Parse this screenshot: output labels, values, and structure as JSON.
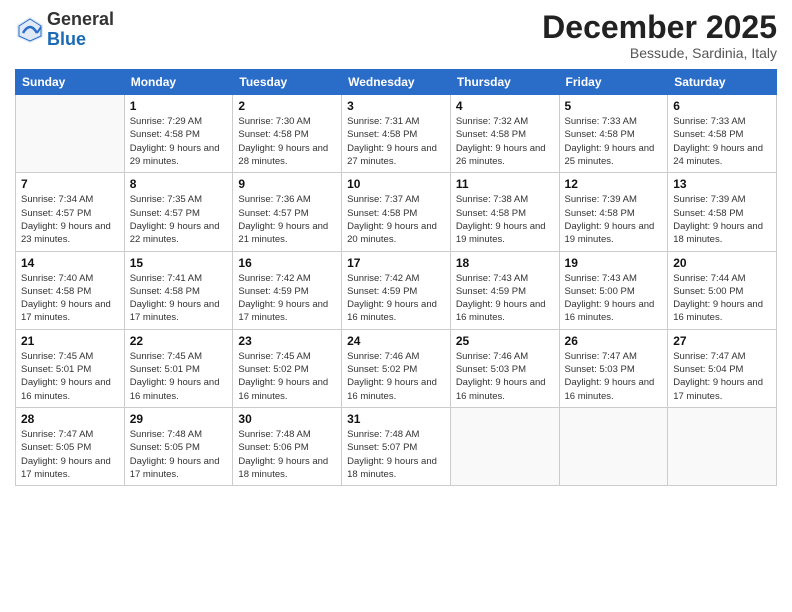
{
  "header": {
    "logo_general": "General",
    "logo_blue": "Blue",
    "month_title": "December 2025",
    "subtitle": "Bessude, Sardinia, Italy"
  },
  "weekdays": [
    "Sunday",
    "Monday",
    "Tuesday",
    "Wednesday",
    "Thursday",
    "Friday",
    "Saturday"
  ],
  "weeks": [
    [
      {
        "day": "",
        "sunrise": "",
        "sunset": "",
        "daylight": ""
      },
      {
        "day": "1",
        "sunrise": "Sunrise: 7:29 AM",
        "sunset": "Sunset: 4:58 PM",
        "daylight": "Daylight: 9 hours and 29 minutes."
      },
      {
        "day": "2",
        "sunrise": "Sunrise: 7:30 AM",
        "sunset": "Sunset: 4:58 PM",
        "daylight": "Daylight: 9 hours and 28 minutes."
      },
      {
        "day": "3",
        "sunrise": "Sunrise: 7:31 AM",
        "sunset": "Sunset: 4:58 PM",
        "daylight": "Daylight: 9 hours and 27 minutes."
      },
      {
        "day": "4",
        "sunrise": "Sunrise: 7:32 AM",
        "sunset": "Sunset: 4:58 PM",
        "daylight": "Daylight: 9 hours and 26 minutes."
      },
      {
        "day": "5",
        "sunrise": "Sunrise: 7:33 AM",
        "sunset": "Sunset: 4:58 PM",
        "daylight": "Daylight: 9 hours and 25 minutes."
      },
      {
        "day": "6",
        "sunrise": "Sunrise: 7:33 AM",
        "sunset": "Sunset: 4:58 PM",
        "daylight": "Daylight: 9 hours and 24 minutes."
      }
    ],
    [
      {
        "day": "7",
        "sunrise": "Sunrise: 7:34 AM",
        "sunset": "Sunset: 4:57 PM",
        "daylight": "Daylight: 9 hours and 23 minutes."
      },
      {
        "day": "8",
        "sunrise": "Sunrise: 7:35 AM",
        "sunset": "Sunset: 4:57 PM",
        "daylight": "Daylight: 9 hours and 22 minutes."
      },
      {
        "day": "9",
        "sunrise": "Sunrise: 7:36 AM",
        "sunset": "Sunset: 4:57 PM",
        "daylight": "Daylight: 9 hours and 21 minutes."
      },
      {
        "day": "10",
        "sunrise": "Sunrise: 7:37 AM",
        "sunset": "Sunset: 4:58 PM",
        "daylight": "Daylight: 9 hours and 20 minutes."
      },
      {
        "day": "11",
        "sunrise": "Sunrise: 7:38 AM",
        "sunset": "Sunset: 4:58 PM",
        "daylight": "Daylight: 9 hours and 19 minutes."
      },
      {
        "day": "12",
        "sunrise": "Sunrise: 7:39 AM",
        "sunset": "Sunset: 4:58 PM",
        "daylight": "Daylight: 9 hours and 19 minutes."
      },
      {
        "day": "13",
        "sunrise": "Sunrise: 7:39 AM",
        "sunset": "Sunset: 4:58 PM",
        "daylight": "Daylight: 9 hours and 18 minutes."
      }
    ],
    [
      {
        "day": "14",
        "sunrise": "Sunrise: 7:40 AM",
        "sunset": "Sunset: 4:58 PM",
        "daylight": "Daylight: 9 hours and 17 minutes."
      },
      {
        "day": "15",
        "sunrise": "Sunrise: 7:41 AM",
        "sunset": "Sunset: 4:58 PM",
        "daylight": "Daylight: 9 hours and 17 minutes."
      },
      {
        "day": "16",
        "sunrise": "Sunrise: 7:42 AM",
        "sunset": "Sunset: 4:59 PM",
        "daylight": "Daylight: 9 hours and 17 minutes."
      },
      {
        "day": "17",
        "sunrise": "Sunrise: 7:42 AM",
        "sunset": "Sunset: 4:59 PM",
        "daylight": "Daylight: 9 hours and 16 minutes."
      },
      {
        "day": "18",
        "sunrise": "Sunrise: 7:43 AM",
        "sunset": "Sunset: 4:59 PM",
        "daylight": "Daylight: 9 hours and 16 minutes."
      },
      {
        "day": "19",
        "sunrise": "Sunrise: 7:43 AM",
        "sunset": "Sunset: 5:00 PM",
        "daylight": "Daylight: 9 hours and 16 minutes."
      },
      {
        "day": "20",
        "sunrise": "Sunrise: 7:44 AM",
        "sunset": "Sunset: 5:00 PM",
        "daylight": "Daylight: 9 hours and 16 minutes."
      }
    ],
    [
      {
        "day": "21",
        "sunrise": "Sunrise: 7:45 AM",
        "sunset": "Sunset: 5:01 PM",
        "daylight": "Daylight: 9 hours and 16 minutes."
      },
      {
        "day": "22",
        "sunrise": "Sunrise: 7:45 AM",
        "sunset": "Sunset: 5:01 PM",
        "daylight": "Daylight: 9 hours and 16 minutes."
      },
      {
        "day": "23",
        "sunrise": "Sunrise: 7:45 AM",
        "sunset": "Sunset: 5:02 PM",
        "daylight": "Daylight: 9 hours and 16 minutes."
      },
      {
        "day": "24",
        "sunrise": "Sunrise: 7:46 AM",
        "sunset": "Sunset: 5:02 PM",
        "daylight": "Daylight: 9 hours and 16 minutes."
      },
      {
        "day": "25",
        "sunrise": "Sunrise: 7:46 AM",
        "sunset": "Sunset: 5:03 PM",
        "daylight": "Daylight: 9 hours and 16 minutes."
      },
      {
        "day": "26",
        "sunrise": "Sunrise: 7:47 AM",
        "sunset": "Sunset: 5:03 PM",
        "daylight": "Daylight: 9 hours and 16 minutes."
      },
      {
        "day": "27",
        "sunrise": "Sunrise: 7:47 AM",
        "sunset": "Sunset: 5:04 PM",
        "daylight": "Daylight: 9 hours and 17 minutes."
      }
    ],
    [
      {
        "day": "28",
        "sunrise": "Sunrise: 7:47 AM",
        "sunset": "Sunset: 5:05 PM",
        "daylight": "Daylight: 9 hours and 17 minutes."
      },
      {
        "day": "29",
        "sunrise": "Sunrise: 7:48 AM",
        "sunset": "Sunset: 5:05 PM",
        "daylight": "Daylight: 9 hours and 17 minutes."
      },
      {
        "day": "30",
        "sunrise": "Sunrise: 7:48 AM",
        "sunset": "Sunset: 5:06 PM",
        "daylight": "Daylight: 9 hours and 18 minutes."
      },
      {
        "day": "31",
        "sunrise": "Sunrise: 7:48 AM",
        "sunset": "Sunset: 5:07 PM",
        "daylight": "Daylight: 9 hours and 18 minutes."
      },
      {
        "day": "",
        "sunrise": "",
        "sunset": "",
        "daylight": ""
      },
      {
        "day": "",
        "sunrise": "",
        "sunset": "",
        "daylight": ""
      },
      {
        "day": "",
        "sunrise": "",
        "sunset": "",
        "daylight": ""
      }
    ]
  ]
}
